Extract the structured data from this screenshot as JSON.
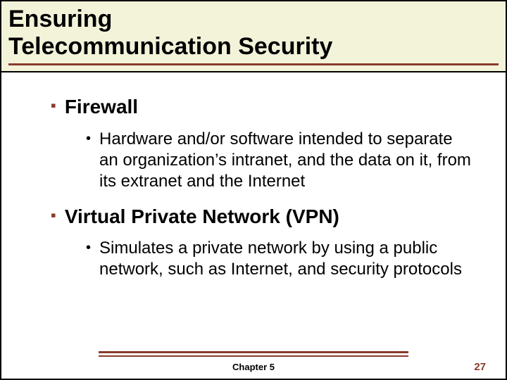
{
  "title_line1": "Ensuring",
  "title_line2": "Telecommunication Security",
  "items": [
    {
      "heading": "Firewall",
      "sub": "Hardware and/or software intended to separate an organization’s intranet, and the data on it, from its extranet and the Internet"
    },
    {
      "heading": "Virtual Private Network (VPN)",
      "sub": "Simulates a private network by using a public network, such as Internet, and security protocols"
    }
  ],
  "chapter_label": "Chapter 5",
  "page_number": "27"
}
